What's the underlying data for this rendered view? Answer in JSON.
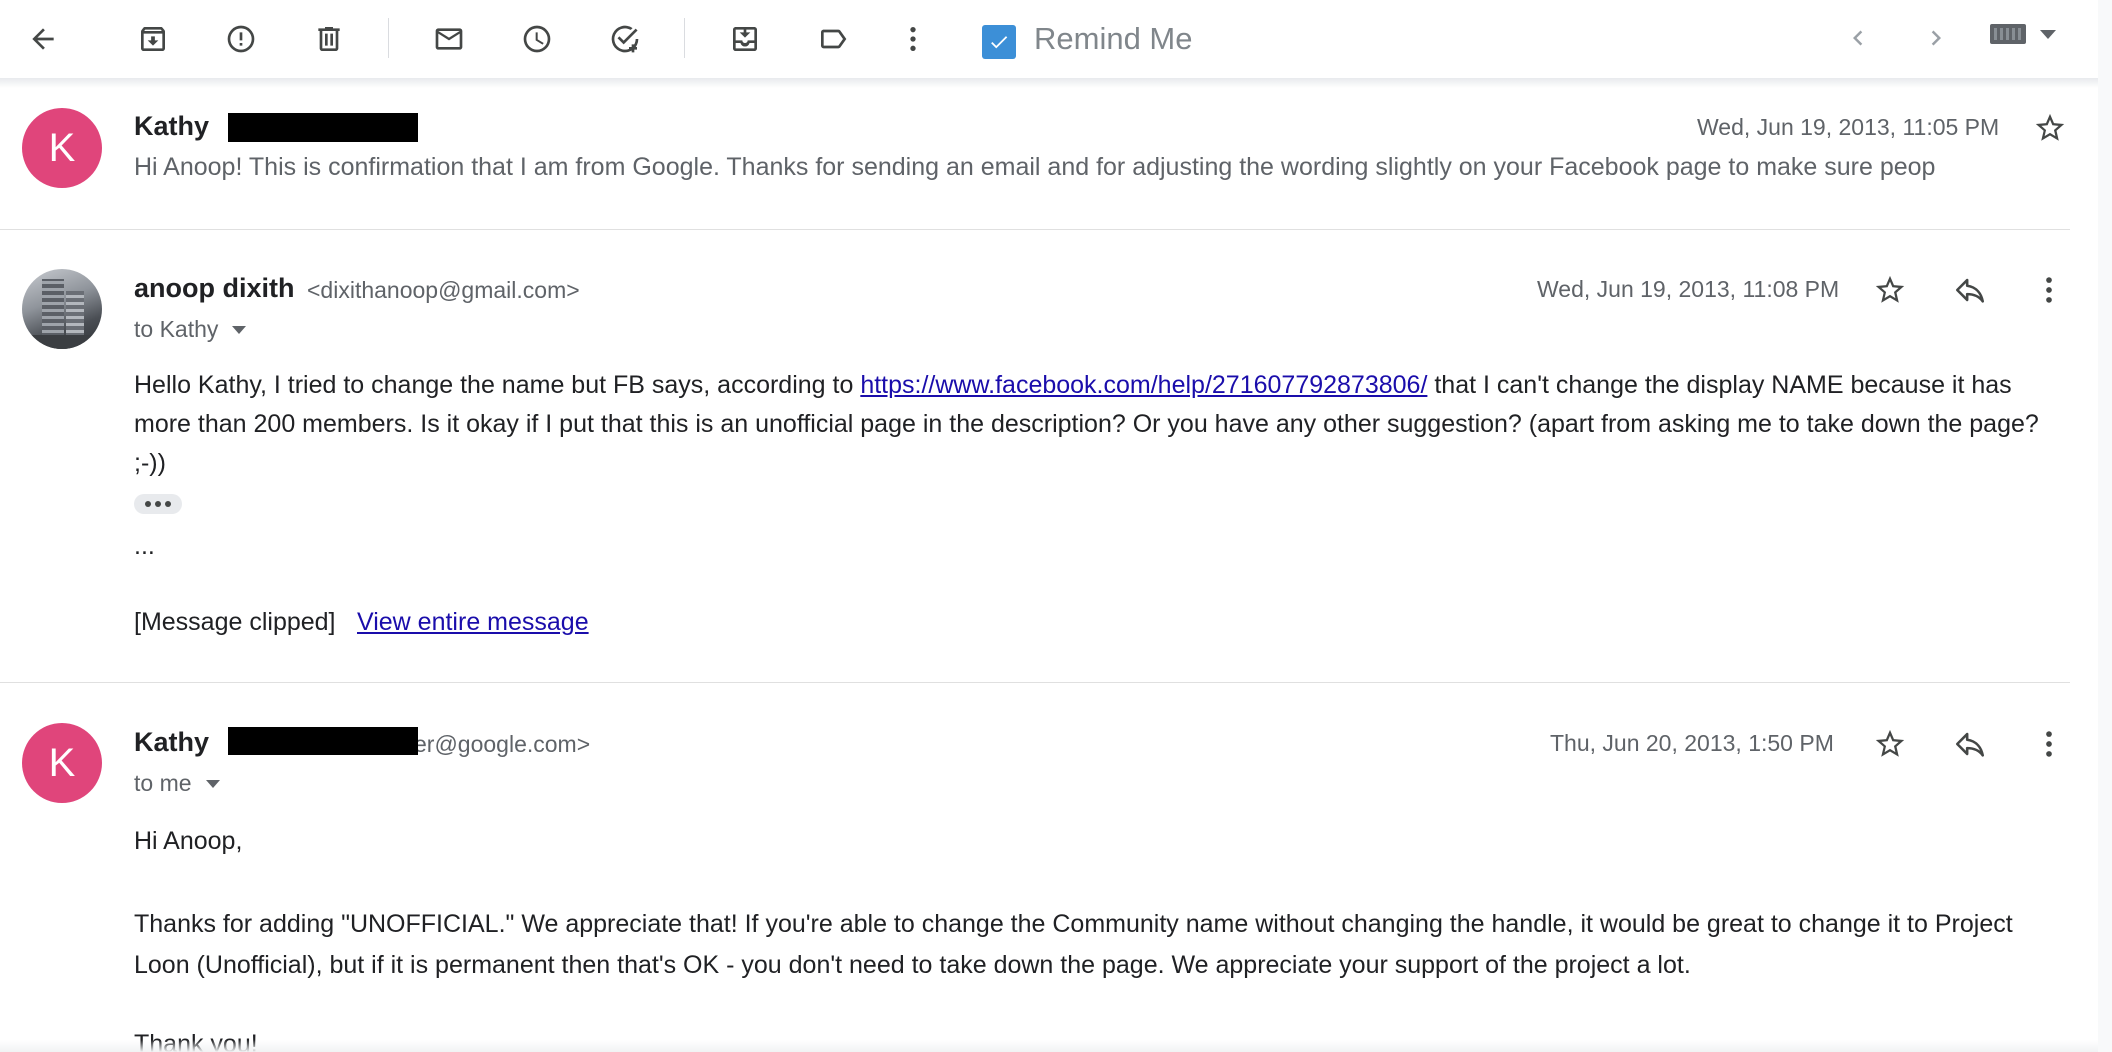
{
  "toolbar": {
    "icons": [
      "back-arrow-icon",
      "archive-icon",
      "report-spam-icon",
      "delete-icon",
      "mark-unread-icon",
      "snooze-icon",
      "add-to-tasks-icon",
      "move-to-icon",
      "label-icon",
      "more-vert-icon"
    ],
    "remind_label": "Remind Me",
    "remind_checked": true,
    "accent": "#3c8fd7"
  },
  "messages": [
    {
      "sender": "Kathy",
      "avatar_letter": "K",
      "avatar_color": "#e0457b",
      "date": "Wed, Jun 19, 2013, 11:05 PM",
      "snippet": "Hi Anoop! This is confirmation that I am from Google. Thanks for sending an email and for adjusting the wording slightly on your Facebook page to make sure peop"
    },
    {
      "sender": "anoop dixith",
      "email": "<dixithanoop@gmail.com>",
      "to": "to Kathy",
      "date": "Wed, Jun 19, 2013, 11:08 PM",
      "body_pre_link": "Hello Kathy, I tried to change the name but FB says, according to ",
      "body_link": "https://www.facebook.com/help/271607792873806/",
      "body_post_link": " that I can't change the display NAME because it has more than 200 members. Is it okay if I put that this is an unofficial page in the description? Or you have any other suggestion? (apart from asking me to take down the page? ;-))",
      "dots": "...",
      "clipped": "[Message clipped]",
      "view_entire": "View entire message"
    },
    {
      "sender": "Kathy",
      "avatar_letter": "K",
      "email_partial": "er@google.com>",
      "to": "to me",
      "date": "Thu, Jun 20, 2013, 1:50 PM",
      "greeting": "Hi Anoop,",
      "paragraph": "Thanks for adding \"UNOFFICIAL.\" We appreciate that! If you're able to change the Community name without changing the handle, it would be great to change it to Project Loon (Unofficial), but if it is permanent then that's OK - you don't need to take down the page. We appreciate your support of the project a lot.",
      "signoff": "Thank you!"
    }
  ]
}
